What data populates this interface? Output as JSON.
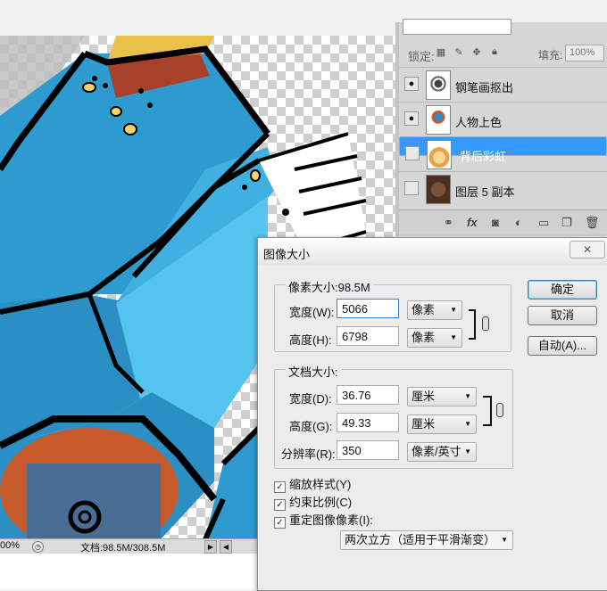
{
  "canvas": {
    "zoom": "00%",
    "doc_info": "文档:98.5M/308.5M"
  },
  "layers_panel": {
    "lock_label": "锁定:",
    "fill_label": "填充:",
    "fill_value": "100%",
    "layers": [
      {
        "name": "钢笔画抠出",
        "visible": true,
        "selected": false
      },
      {
        "name": "人物上色",
        "visible": true,
        "selected": false
      },
      {
        "name": "背后彩虹",
        "visible": false,
        "selected": true
      },
      {
        "name": "图层 5 副本",
        "visible": false,
        "selected": false
      }
    ],
    "bottom_icons": [
      "link-icon",
      "fx-icon",
      "mask-icon",
      "adjustment-icon",
      "group-icon",
      "new-layer-icon",
      "trash-icon"
    ],
    "fx_label": "fx"
  },
  "dialog": {
    "title": "图像大小",
    "close": "✕",
    "pixel_dimensions": {
      "title": "像素大小:98.5M",
      "width_label": "宽度(W):",
      "width_value": "5066",
      "width_unit": "像素",
      "height_label": "高度(H):",
      "height_value": "6798",
      "height_unit": "像素"
    },
    "document_size": {
      "title": "文档大小:",
      "width_label": "宽度(D):",
      "width_value": "36.76",
      "width_unit": "厘米",
      "height_label": "高度(G):",
      "height_value": "49.33",
      "height_unit": "厘米",
      "resolution_label": "分辨率(R):",
      "resolution_value": "350",
      "resolution_unit": "像素/英寸"
    },
    "buttons": {
      "ok": "确定",
      "cancel": "取消",
      "auto": "自动(A)..."
    },
    "checkboxes": [
      {
        "label": "缩放样式(Y)",
        "checked": true
      },
      {
        "label": "约束比例(C)",
        "checked": true
      },
      {
        "label": "重定图像像素(I):",
        "checked": true
      }
    ],
    "resample_method": "两次立方（适用于平滑渐变）"
  }
}
